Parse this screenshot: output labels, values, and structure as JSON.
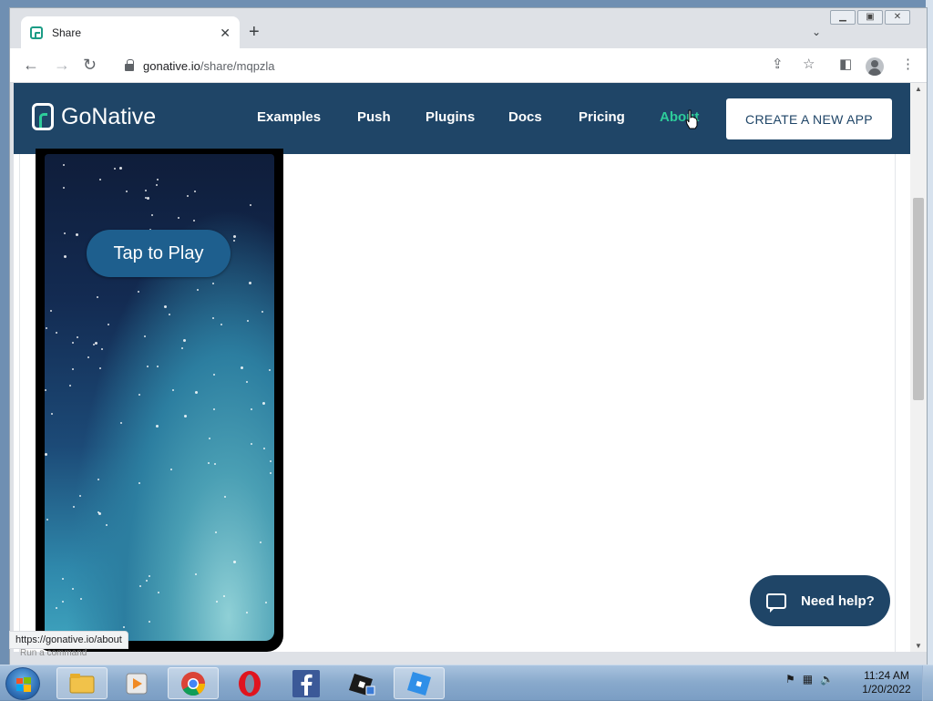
{
  "browser": {
    "tab": {
      "title": "Share",
      "close_icon": "close-icon"
    },
    "new_tab_label": "+",
    "tab_search_icon": "chevron-down-icon",
    "window_controls": {
      "minimize": "—",
      "maximize": "□",
      "close": "✕"
    },
    "url": {
      "domain": "gonative.io",
      "path": "/share/mqpzla"
    },
    "status_url": "https://gonative.io/about"
  },
  "site": {
    "brand": "GoNative",
    "nav": [
      "Examples",
      "Push",
      "Plugins",
      "Docs",
      "Pricing",
      "About"
    ],
    "active_nav": "About",
    "cta": "CREATE A NEW APP",
    "phone": {
      "button": "Tap to Play"
    },
    "help": "Need help?",
    "colors": {
      "header": "#1f4567",
      "accent": "#2ecc9a",
      "button_blue": "#1e5f8e"
    }
  },
  "overlay": {
    "run_command": "Run a command"
  },
  "taskbar": {
    "apps": [
      "windows-explorer",
      "media-player",
      "chrome",
      "opera",
      "facebook",
      "roblox-studio",
      "roblox"
    ],
    "clock": {
      "time": "11:24 AM",
      "date": "1/20/2022"
    }
  }
}
